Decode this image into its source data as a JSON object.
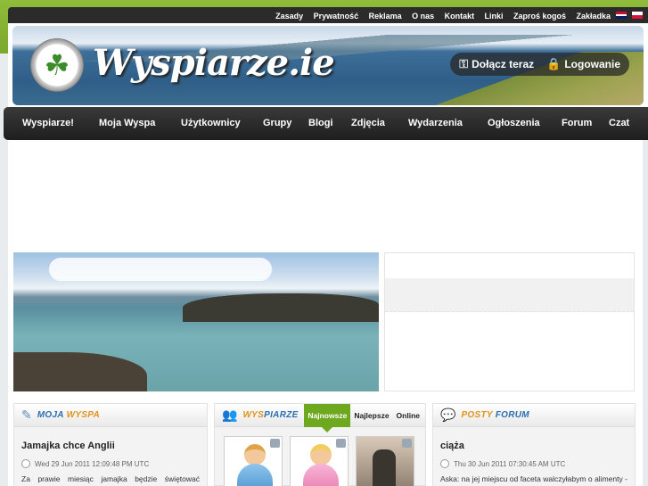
{
  "topbar": {
    "links": [
      "Zasady",
      "Prywatność",
      "Reklama",
      "O nas",
      "Kontakt",
      "Linki",
      "Zaproś kogoś",
      "Zakładka"
    ]
  },
  "header": {
    "logo_text": "Wyspiarze.ie",
    "join_label": "Dołącz teraz",
    "login_label": "Logowanie"
  },
  "nav": {
    "items": [
      "Wyspiarze!",
      "Moja Wyspa",
      "Użytkownicy",
      "Grupy",
      "Blogi",
      "Zdjęcia",
      "Wydarzenia",
      "Ogłoszenia",
      "Forum",
      "Czat"
    ]
  },
  "panels": {
    "moja_wyspa": {
      "title_a": "MOJA",
      "title_b": "WYSPA",
      "post_title": "Jamajka chce Anglii",
      "post_date": "Wed 29 Jun 2011 12:09:48 PM UTC",
      "post_text": "Za prawie miesiąc jamajka będzie świętować pięćdziesiątą rocznicę niepodległości i wcale się"
    },
    "wyspiarze": {
      "title_a": "WYS",
      "title_b": "PIARZE",
      "tabs": [
        "Najnowsze",
        "Najlepsze",
        "Online"
      ]
    },
    "posty_forum": {
      "title_a": "POSTY",
      "title_b": "FORUM",
      "post_title": "ciąża",
      "post_date": "Thu 30 Jun 2011 07:30:45 AM UTC",
      "post_text": "Aska: na jej miejscu od faceta walczyłabym o alimenty - to po pierwsze. A potem wyjechała do"
    }
  },
  "colors": {
    "accent_green": "#6ea81f",
    "title_blue": "#2a6db0",
    "title_orange": "#e0921a",
    "nav_bg": "#2b2b2b"
  }
}
